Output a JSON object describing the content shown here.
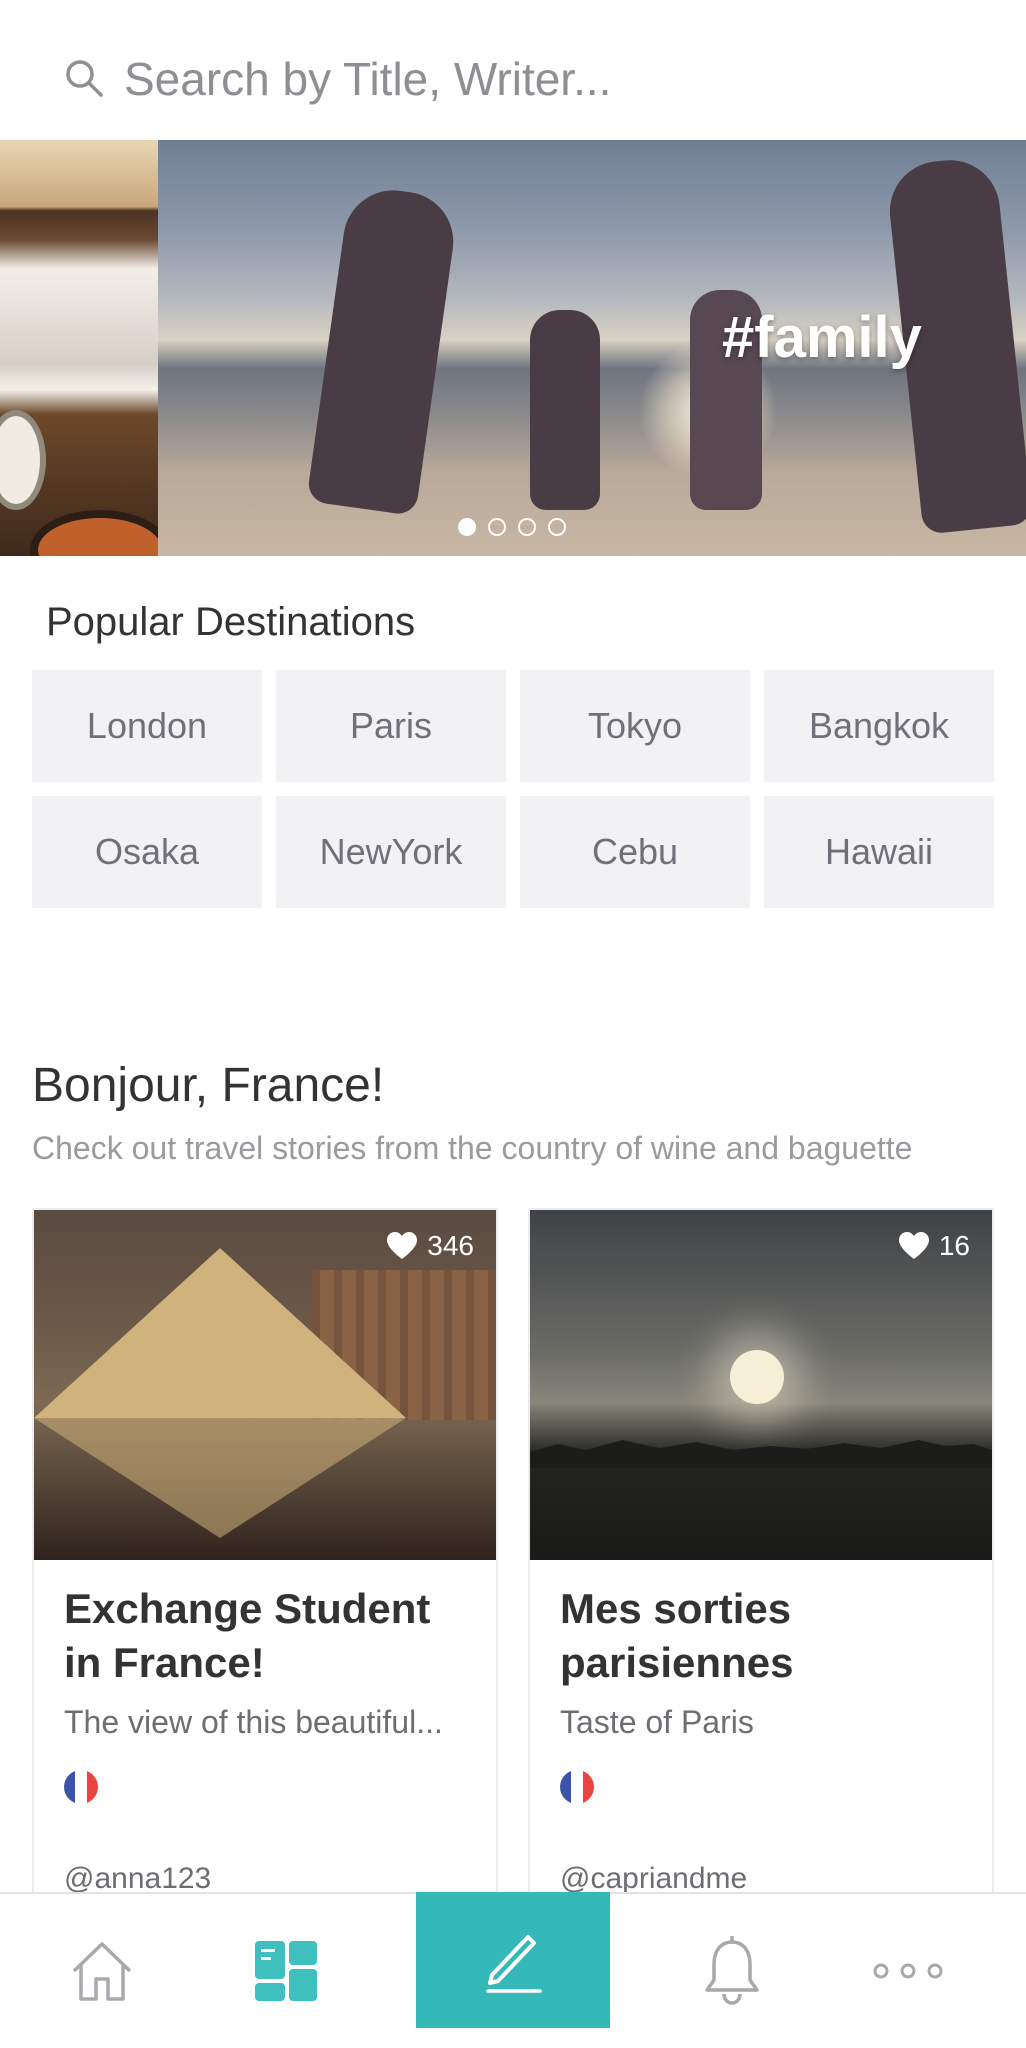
{
  "search": {
    "placeholder": "Search by Title, Writer..."
  },
  "banner": {
    "tag": "#family",
    "slide_count": 4,
    "active_slide": 1
  },
  "popular": {
    "title": "Popular Destinations",
    "items": [
      "London",
      "Paris",
      "Tokyo",
      "Bangkok",
      "Osaka",
      "NewYork",
      "Cebu",
      "Hawaii"
    ]
  },
  "feature": {
    "title": "Bonjour, France!",
    "subtitle": "Check out travel stories from the country of wine and baguette",
    "cards": [
      {
        "likes": "346",
        "title": "Exchange Student in France!",
        "description": "The view of this beautiful...",
        "flag": "france-flag-icon",
        "author": "@anna123"
      },
      {
        "likes": "16",
        "title": "Mes sorties parisiennes",
        "description": "Taste of Paris",
        "flag": "france-flag-icon",
        "author": "@capriandme"
      }
    ]
  },
  "tabbar": {
    "items": [
      "home-icon",
      "feed-icon",
      "write-icon",
      "bell-icon",
      "more-icon"
    ],
    "accent": "#35b9b8",
    "feed_color": "#3fbfbd",
    "inactive_color": "#a9a9ad"
  },
  "colors": {
    "tile_bg": "#f2f2f4",
    "flag_blue": "#3b54a8",
    "flag_red": "#e8463f"
  }
}
